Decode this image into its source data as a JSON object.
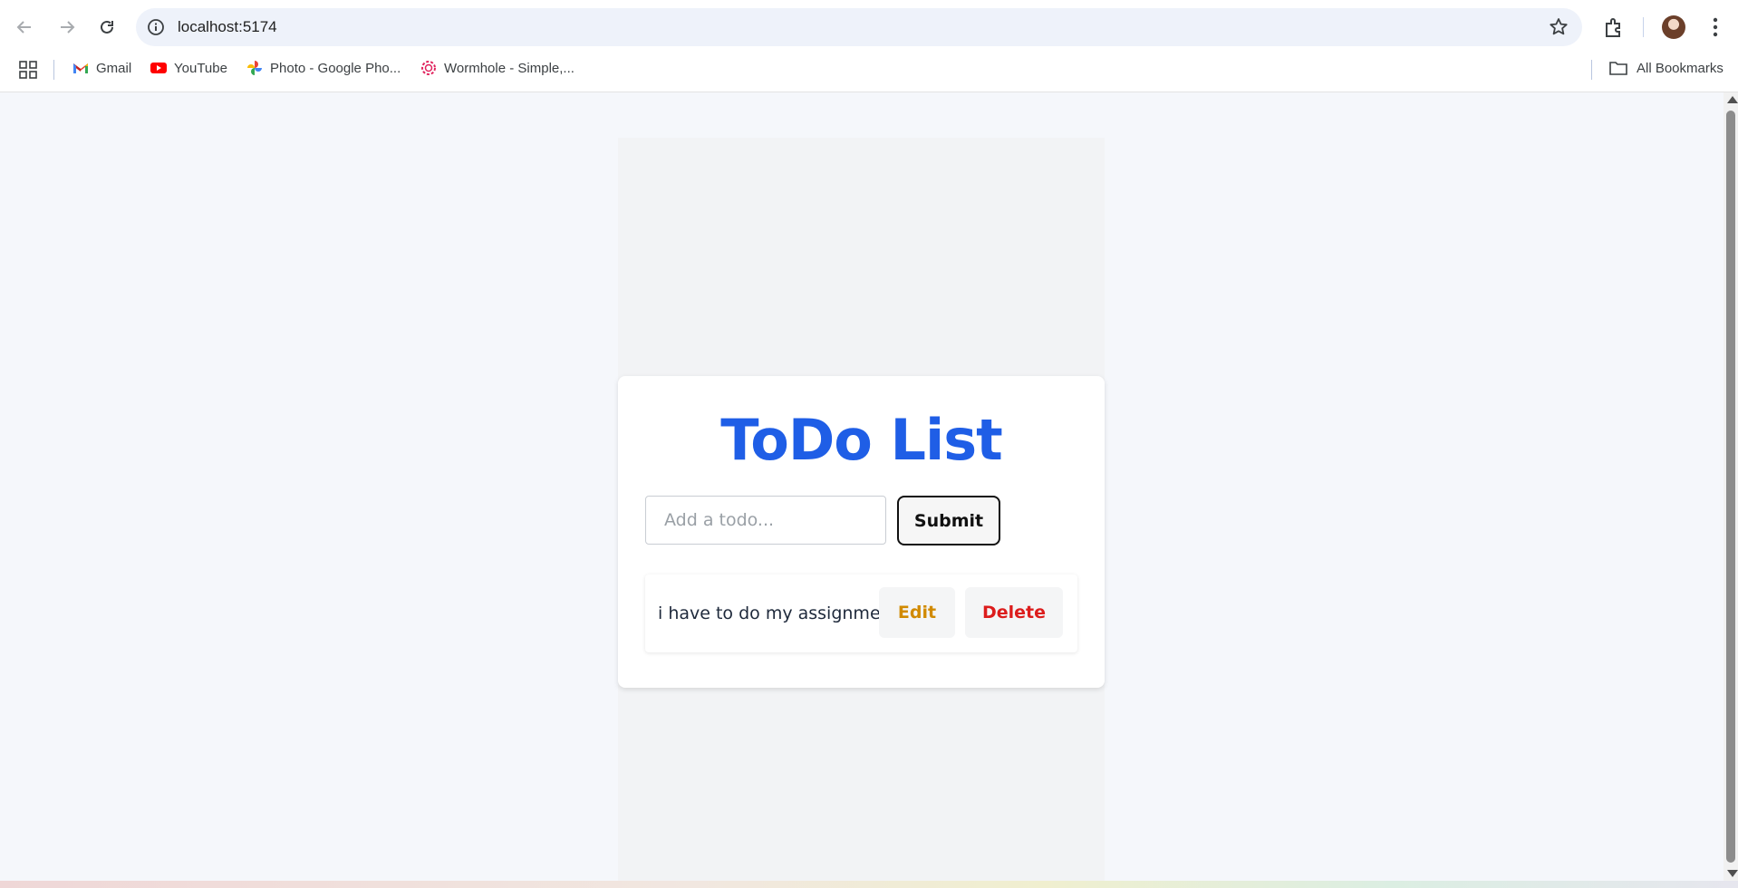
{
  "browser": {
    "url": "localhost:5174",
    "bookmarks": [
      {
        "label": "Gmail",
        "icon": "gmail-icon"
      },
      {
        "label": "YouTube",
        "icon": "youtube-icon"
      },
      {
        "label": "Photo - Google Pho...",
        "icon": "google-photos-icon"
      },
      {
        "label": "Wormhole - Simple,...",
        "icon": "wormhole-icon"
      }
    ],
    "all_bookmarks_label": "All Bookmarks"
  },
  "app": {
    "title": "ToDo List",
    "input_placeholder": "Add a todo...",
    "input_value": "",
    "submit_label": "Submit",
    "todos": [
      {
        "text": "i have to do my assignment",
        "edit_label": "Edit",
        "delete_label": "Delete"
      }
    ]
  },
  "colors": {
    "title": "#1f5ee6",
    "edit": "#d18a00",
    "delete": "#dc1c1c",
    "page_bg": "#f5f7fb"
  }
}
